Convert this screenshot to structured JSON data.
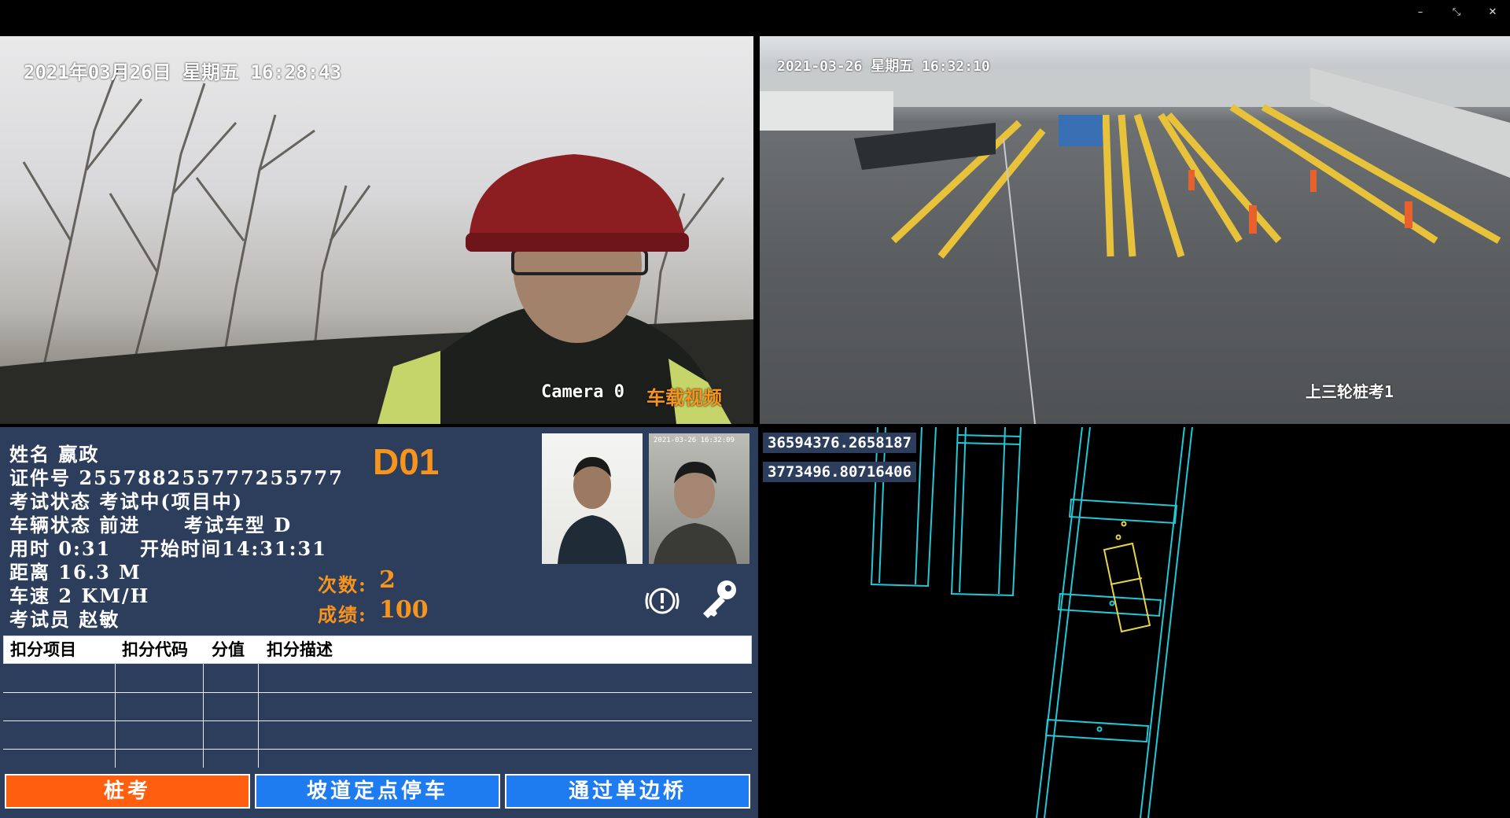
{
  "window": {
    "minimize": "–",
    "restore": "⤡",
    "close": "✕"
  },
  "camera1": {
    "timestamp": "2021年03月26日 星期五 16:28:43",
    "label_camera": "Camera 0",
    "label_name": "车载视频"
  },
  "camera2": {
    "timestamp": "2021-03-26 星期五 16:32:10",
    "label": "上三轮桩考1"
  },
  "exam": {
    "name": "姓名 嬴政",
    "id": "证件号 255788255777255777",
    "status": "考试状态 考试中(项目中)",
    "vehicle": "车辆状态 前进",
    "vehicle_type": "考试车型 D",
    "elapsed": "用时 0:31",
    "start": "开始时间14:31:31",
    "distance": "距离 16.3 M",
    "speed": "车速 2 KM/H",
    "examiner": "考试员 赵敏",
    "code": "D01",
    "count_label": "次数:",
    "count_value": "2",
    "score_label": "成绩:",
    "score_value": "100"
  },
  "photo2": {
    "caption": "2021-03-26 16:32:09"
  },
  "deductions": {
    "headers": [
      "扣分项目",
      "扣分代码",
      "分值",
      "扣分描述"
    ],
    "rows": []
  },
  "items": [
    "桩考",
    "坡道定点停车",
    "通过单边桥"
  ],
  "map": {
    "coord_x": "36594376.2658187",
    "coord_y": "3773496.80716406"
  },
  "colors": {
    "panel": "#2d3e5c",
    "accent": "#f7941d",
    "active_item": "#ff5f0f",
    "item": "#1e7bf0",
    "map_lines": "#22c8d8",
    "car": "#e5d44a"
  }
}
